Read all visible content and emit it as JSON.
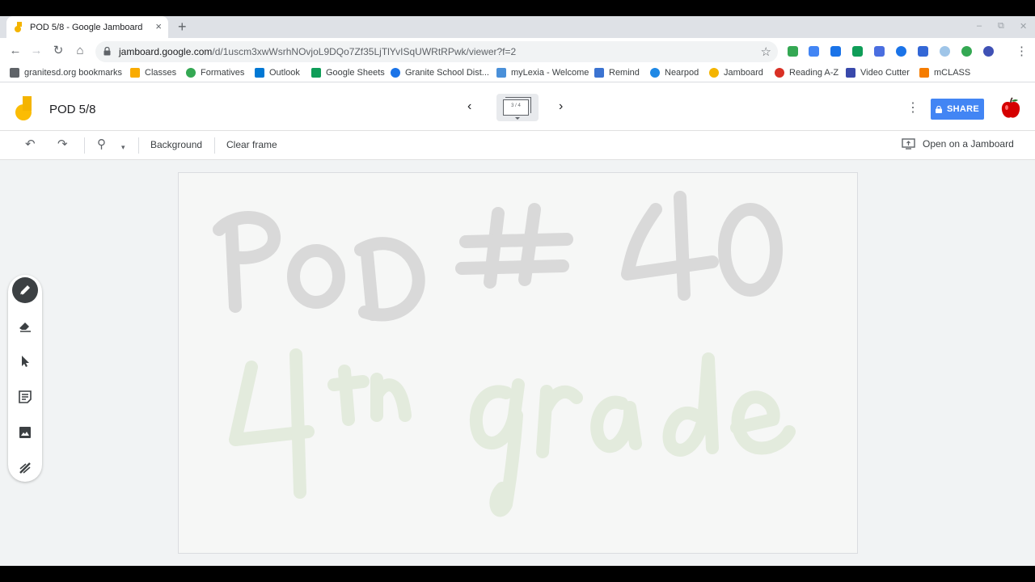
{
  "browser": {
    "tab_title": "POD 5/8 - Google Jamboard",
    "tab_close": "×",
    "new_tab": "+",
    "url_host": "jamboard.google.com",
    "url_path": "/d/1uscm3xwWsrhNOvjoL9DQo7Zf35LjTlYvISqUWRtRPwk/viewer?f=2",
    "nav": {
      "back": "←",
      "forward": "→",
      "reload": "↻",
      "home": "⌂",
      "star": "☆",
      "menu": "⋮"
    },
    "window_controls": {
      "minimize": "–",
      "restore": "⧉",
      "close": "✕"
    }
  },
  "bookmarks": [
    {
      "label": "granitesd.org bookmarks",
      "icon": "folder-icon",
      "color": "#5f6368"
    },
    {
      "label": "Classes",
      "icon": "classroom-icon",
      "color": "#f9ab00"
    },
    {
      "label": "Formatives",
      "icon": "formative-icon",
      "color": "#34a853"
    },
    {
      "label": "Outlook",
      "icon": "outlook-icon",
      "color": "#0078d4"
    },
    {
      "label": "Google Sheets",
      "icon": "sheets-icon",
      "color": "#0f9d58"
    },
    {
      "label": "Granite School Dist...",
      "icon": "granite-icon",
      "color": "#1a73e8"
    },
    {
      "label": "myLexia - Welcome",
      "icon": "lexia-icon",
      "color": "#4a90d9"
    },
    {
      "label": "Remind",
      "icon": "remind-icon",
      "color": "#3b73d1"
    },
    {
      "label": "Nearpod",
      "icon": "nearpod-icon",
      "color": "#1e88e5"
    },
    {
      "label": "Jamboard",
      "icon": "jamboard-icon",
      "color": "#f4b400"
    },
    {
      "label": "Reading A-Z",
      "icon": "reading-az-icon",
      "color": "#d93025"
    },
    {
      "label": "Video Cutter",
      "icon": "video-cutter-icon",
      "color": "#3949ab"
    },
    {
      "label": "mCLASS",
      "icon": "mclass-icon",
      "color": "#f57c00"
    }
  ],
  "app": {
    "title": "POD 5/8",
    "pager_prev": "‹",
    "pager_next": "›",
    "frame_indicator": "3 / 4",
    "menu": "⋮",
    "share_label": "SHARE",
    "brand_color": "#4285f4"
  },
  "toolbar": {
    "undo": "↶",
    "redo": "↷",
    "zoom": "⚲",
    "zoom_caret": "▾",
    "background_label": "Background",
    "clear_label": "Clear frame",
    "open_label": "Open on a Jamboard"
  },
  "tools": [
    {
      "name": "pen-tool",
      "icon": "pen-icon",
      "active": true
    },
    {
      "name": "eraser-tool",
      "icon": "eraser-icon",
      "active": false
    },
    {
      "name": "select-tool",
      "icon": "select-arrow-icon",
      "active": false
    },
    {
      "name": "sticky-note-tool",
      "icon": "sticky-note-icon",
      "active": false
    },
    {
      "name": "image-tool",
      "icon": "image-icon",
      "active": false
    },
    {
      "name": "laser-tool",
      "icon": "laser-icon",
      "active": false
    }
  ],
  "board": {
    "handwriting_line1": "PoD # 40",
    "handwriting_line2": "4th grade",
    "line1_color": "#d9d9d9",
    "line2_color": "#e3ebdd"
  }
}
